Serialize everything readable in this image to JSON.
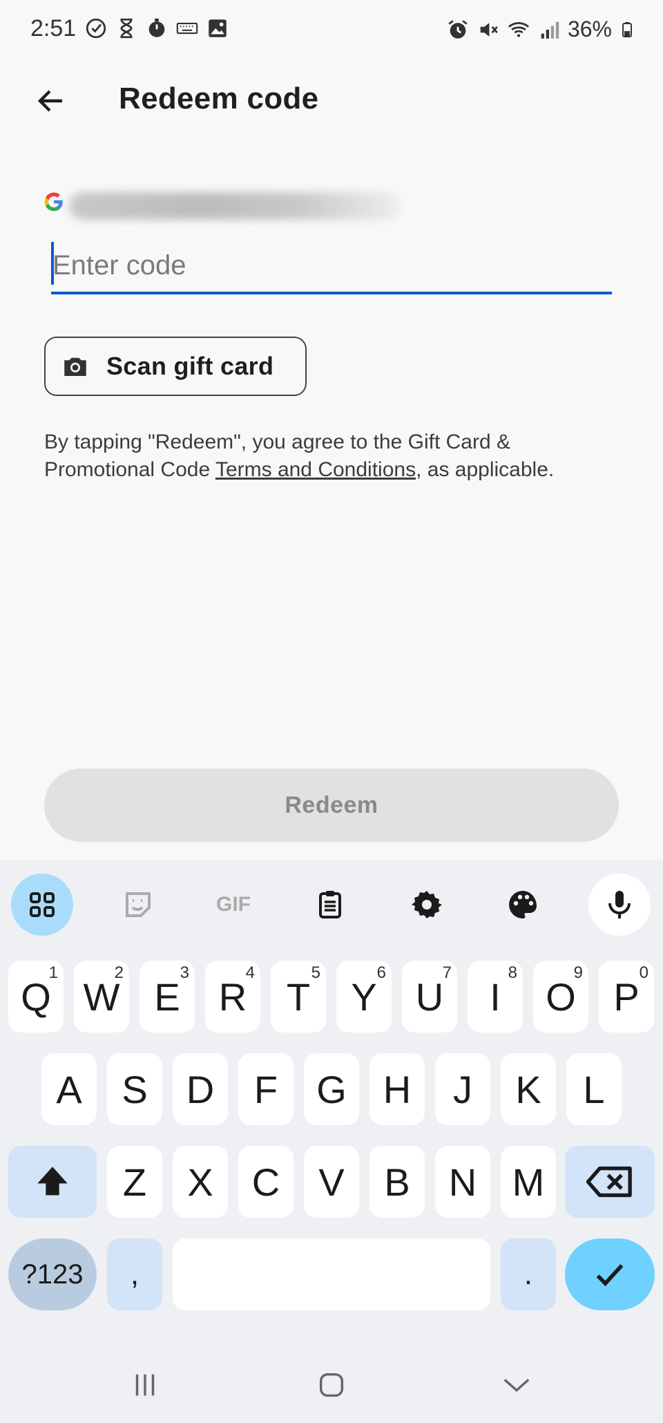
{
  "status_bar": {
    "time": "2:51",
    "battery": "36%",
    "left_icons": [
      "check-circle-icon",
      "hourglass-icon",
      "timer-icon",
      "keyboard-icon",
      "image-icon"
    ],
    "right_icons": [
      "alarm-icon",
      "mute-icon",
      "wifi-icon",
      "signal-icon",
      "battery-icon"
    ]
  },
  "header": {
    "title": "Redeem code"
  },
  "account": {
    "provider_icon": "google-icon"
  },
  "code_input": {
    "placeholder": "Enter code",
    "value": ""
  },
  "scan_button": {
    "label": "Scan gift card",
    "icon": "camera-icon"
  },
  "terms": {
    "prefix": "By tapping \"Redeem\", you agree to the Gift Card & Promotional Code ",
    "link": "Terms and Conditions",
    "suffix": ", as applicable."
  },
  "redeem_button": {
    "label": "Redeem"
  },
  "keyboard": {
    "toolbar": [
      "apps-grid-icon",
      "sticker-icon",
      "gif-icon",
      "clipboard-icon",
      "settings-icon",
      "palette-icon",
      "mic-icon"
    ],
    "row1": [
      {
        "key": "Q",
        "hint": "1"
      },
      {
        "key": "W",
        "hint": "2"
      },
      {
        "key": "E",
        "hint": "3"
      },
      {
        "key": "R",
        "hint": "4"
      },
      {
        "key": "T",
        "hint": "5"
      },
      {
        "key": "Y",
        "hint": "6"
      },
      {
        "key": "U",
        "hint": "7"
      },
      {
        "key": "I",
        "hint": "8"
      },
      {
        "key": "O",
        "hint": "9"
      },
      {
        "key": "P",
        "hint": "0"
      }
    ],
    "row2": [
      "A",
      "S",
      "D",
      "F",
      "G",
      "H",
      "J",
      "K",
      "L"
    ],
    "row3": [
      "Z",
      "X",
      "C",
      "V",
      "B",
      "N",
      "M"
    ],
    "symbols_label": "?123",
    "comma": ",",
    "period": ".",
    "gif_label": "GIF"
  },
  "nav_bar": {
    "buttons": [
      "recents-icon",
      "home-icon",
      "back-down-icon"
    ]
  },
  "colors": {
    "accent": "#0b57d0",
    "enter_key": "#6fd1ff",
    "modifier_key": "#d3e3f8"
  }
}
